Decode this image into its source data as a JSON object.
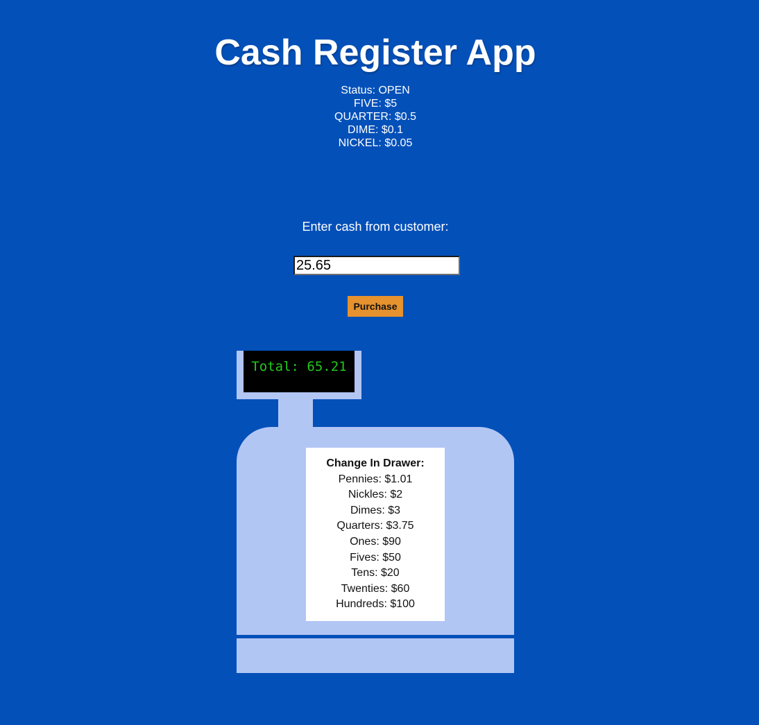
{
  "app": {
    "title": "Cash Register App"
  },
  "change_due": {
    "lines": [
      "Status: OPEN",
      "FIVE: $5",
      "QUARTER: $0.5",
      "DIME: $0.1",
      "NICKEL: $0.05"
    ]
  },
  "form": {
    "prompt": "Enter cash from customer:",
    "cash_value": "25.65",
    "purchase_label": "Purchase"
  },
  "register": {
    "total_display": "Total: 65.21",
    "drawer_title": "Change In Drawer:",
    "drawer_items": [
      "Pennies: $1.01",
      "Nickles: $2",
      "Dimes: $3",
      "Quarters: $3.75",
      "Ones: $90",
      "Fives: $50",
      "Tens: $20",
      "Twenties: $60",
      "Hundreds: $100"
    ]
  },
  "colors": {
    "background": "#0450b9",
    "register": "#b2c6f4",
    "display_text": "#22c91d",
    "button": "#e6922e"
  }
}
